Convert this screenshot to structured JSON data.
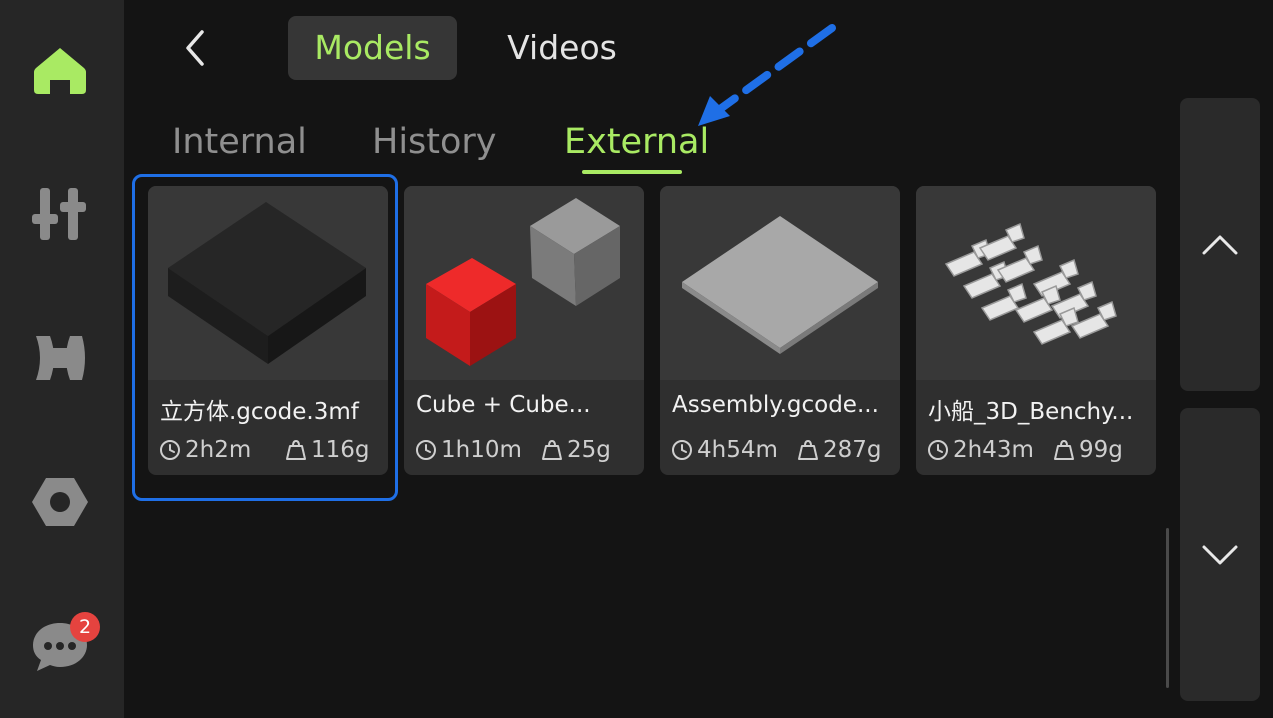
{
  "sidebar": {
    "items": [
      {
        "icon": "home-icon",
        "active": true
      },
      {
        "icon": "sliders-icon",
        "active": false
      },
      {
        "icon": "filament-spool-icon",
        "active": false
      },
      {
        "icon": "hex-nut-icon",
        "active": false
      },
      {
        "icon": "chat-bubble-icon",
        "active": false
      }
    ],
    "notification_count": "2"
  },
  "header": {
    "back_icon": "chevron-left-icon",
    "tabs": [
      {
        "label": "Models",
        "active": true
      },
      {
        "label": "Videos",
        "active": false
      }
    ]
  },
  "subtabs": [
    {
      "label": "Internal",
      "active": false
    },
    {
      "label": "History",
      "active": false
    },
    {
      "label": "External",
      "active": true
    }
  ],
  "models": [
    {
      "name": "立方体.gcode.3mf",
      "time": "2h2m",
      "weight": "116g",
      "selected": true
    },
    {
      "name": "Cube + Cube...",
      "time": "1h10m",
      "weight": "25g",
      "selected": false
    },
    {
      "name": "Assembly.gcode...",
      "time": "4h54m",
      "weight": "287g",
      "selected": false
    },
    {
      "name": "小船_3D_Benchy...",
      "time": "2h43m",
      "weight": "99g",
      "selected": false
    }
  ],
  "scroll": {
    "up_icon": "chevron-up-icon",
    "down_icon": "chevron-down-icon"
  },
  "colors": {
    "accent": "#a9ea63",
    "selection": "#1f6fe6",
    "badge": "#e5433f",
    "background": "#141414",
    "sidebar": "#262626"
  }
}
